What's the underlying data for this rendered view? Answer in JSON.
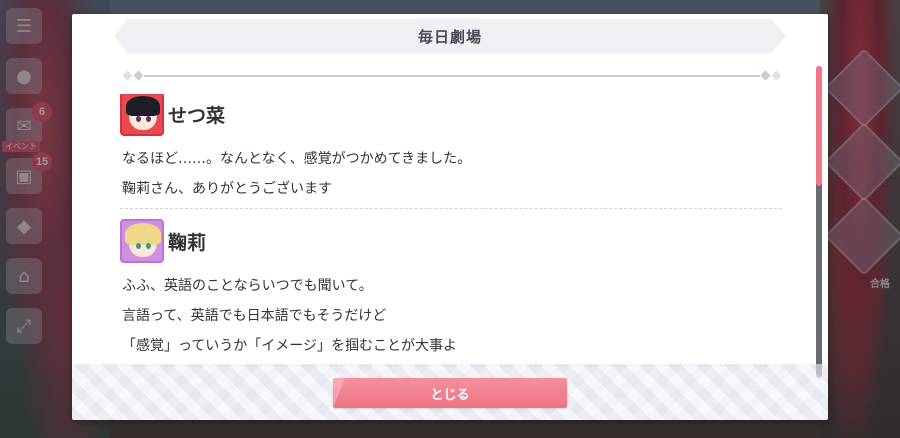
{
  "dialog": {
    "title": "毎日劇場",
    "close_label": "とじる"
  },
  "side_menu": {
    "badges": [
      "6",
      "15"
    ],
    "event_tag": "イベント"
  },
  "right_panel": {
    "label": "合格"
  },
  "entries": [
    {
      "speaker": "せつ菜",
      "avatar_icon": "setsuna-avatar-icon",
      "lines": [
        "なるほど……。なんとなく、感覚がつかめてきました。",
        "鞠莉さん、ありがとうございます"
      ]
    },
    {
      "speaker": "鞠莉",
      "avatar_icon": "mari-avatar-icon",
      "lines": [
        "ふふ、英語のことならいつでも聞いて。",
        "言語って、英語でも日本語でもそうだけど",
        "「感覚」っていうか「イメージ」を掴むことが大事よ"
      ]
    }
  ],
  "colors": {
    "accent": "#ee7484",
    "scroll_thumb": "#f07888",
    "title_bar": "#eef0f4"
  }
}
